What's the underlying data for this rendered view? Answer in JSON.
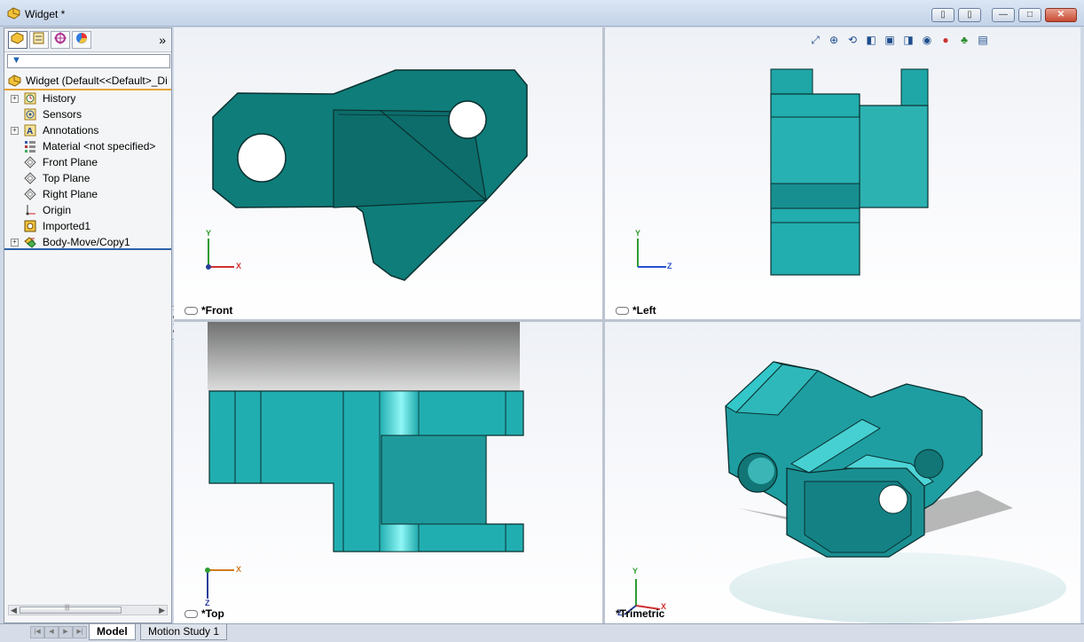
{
  "window": {
    "title": "Widget *",
    "app_icon": "solidworks-part-icon"
  },
  "feature_manager": {
    "tabs": [
      "featuremanager-tab",
      "propertymanager-tab",
      "configurationmanager-tab",
      "displaymanager-tab"
    ],
    "more": "»",
    "root_label": "Widget  (Default<<Default>_Di",
    "items": [
      {
        "label": "History",
        "icon": "history-icon",
        "expandable": true
      },
      {
        "label": "Sensors",
        "icon": "sensors-icon",
        "expandable": false
      },
      {
        "label": "Annotations",
        "icon": "annotations-icon",
        "expandable": true
      },
      {
        "label": "Material <not specified>",
        "icon": "material-icon",
        "expandable": false
      },
      {
        "label": "Front Plane",
        "icon": "plane-icon",
        "expandable": false
      },
      {
        "label": "Top Plane",
        "icon": "plane-icon",
        "expandable": false
      },
      {
        "label": "Right Plane",
        "icon": "plane-icon",
        "expandable": false
      },
      {
        "label": "Origin",
        "icon": "origin-icon",
        "expandable": false
      },
      {
        "label": "Imported1",
        "icon": "imported-feature-icon",
        "expandable": false
      },
      {
        "label": "Body-Move/Copy1",
        "icon": "move-copy-icon",
        "expandable": true
      }
    ]
  },
  "viewports": {
    "front": {
      "label": "*Front"
    },
    "left": {
      "label": "*Left"
    },
    "top": {
      "label": "*Top"
    },
    "trimetric": {
      "label": "*Trimetric"
    }
  },
  "axes": {
    "x": "X",
    "y": "Y",
    "z": "Z"
  },
  "bottom_tabs": {
    "model": "Model",
    "motion": "Motion Study 1"
  },
  "colors": {
    "part_teal": "#0f7d7a",
    "part_cyan": "#27b5b8",
    "selection_orange": "#e6a23a"
  }
}
